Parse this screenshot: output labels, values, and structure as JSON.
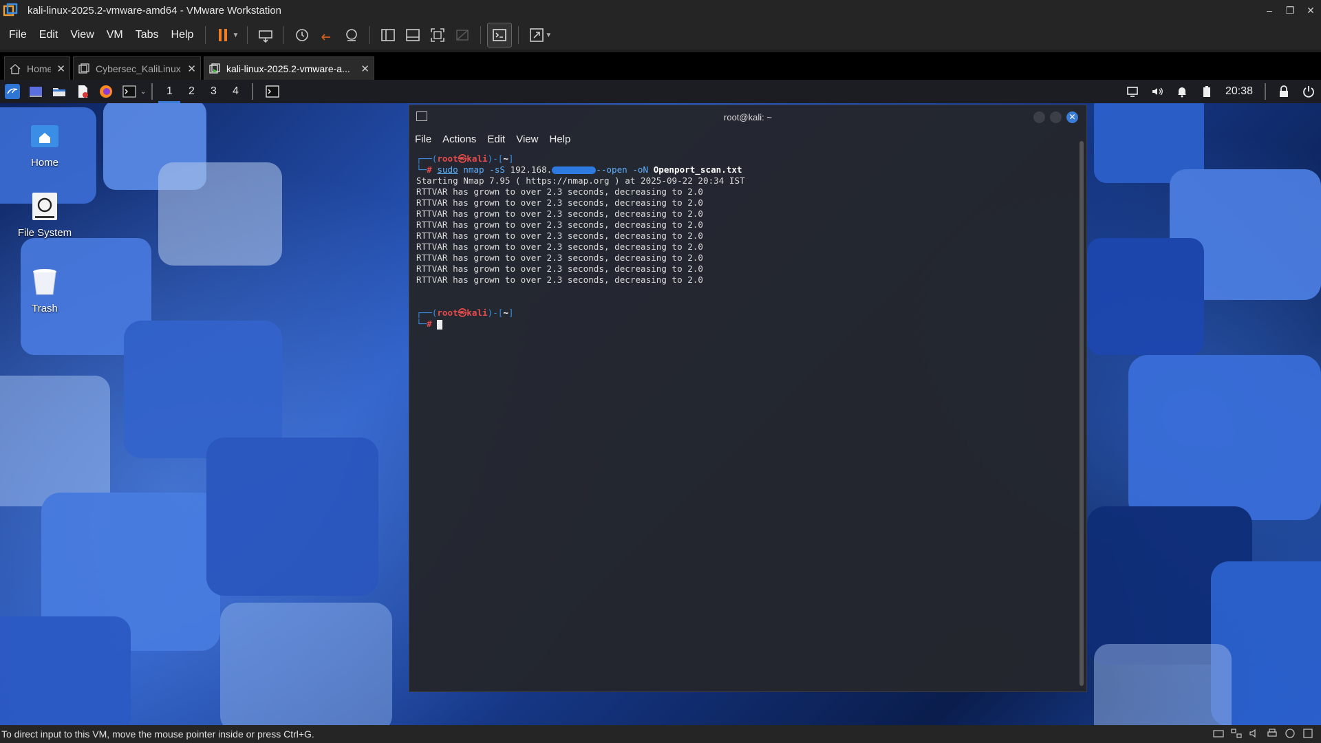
{
  "window": {
    "title": "kali-linux-2025.2-vmware-amd64 - VMware Workstation",
    "controls": [
      "minimize-icon",
      "restore-icon",
      "close-icon"
    ]
  },
  "menubar": {
    "items": [
      "File",
      "Edit",
      "View",
      "VM",
      "Tabs",
      "Help"
    ]
  },
  "tabs": [
    {
      "label": "Home",
      "icon": "home-icon"
    },
    {
      "label": "Cybersec_KaliLinux",
      "icon": "vm-icon"
    },
    {
      "label": "kali-linux-2025.2-vmware-a...",
      "icon": "vm-running-icon"
    }
  ],
  "guest_panel": {
    "workspaces": [
      "1",
      "2",
      "3",
      "4"
    ],
    "active_workspace": "1",
    "clock": "20:38"
  },
  "desktop_icons": [
    {
      "label": "Home"
    },
    {
      "label": "File System"
    },
    {
      "label": "Trash"
    }
  ],
  "terminal": {
    "title": "root@kali: ~",
    "menu": [
      "File",
      "Actions",
      "Edit",
      "View",
      "Help"
    ],
    "prompt_user": "root",
    "prompt_at": "㉿",
    "prompt_host": "kali",
    "prompt_dir": "~",
    "cmd_sudo": "sudo",
    "cmd_nmap": "nmap",
    "cmd_flag": "-sS",
    "cmd_ip": "192.168.",
    "cmd_open": "--open",
    "cmd_on": "-oN",
    "cmd_file": "Openport_scan.txt",
    "output_start": "Starting Nmap 7.95 ( https://nmap.org ) at 2025-09-22 20:34 IST",
    "rttvar_line": "RTTVAR has grown to over 2.3 seconds, decreasing to 2.0",
    "rttvar_count": 9
  },
  "statusbar": {
    "message": "To direct input to this VM, move the mouse pointer inside or press Ctrl+G."
  },
  "colors": {
    "accent": "#3a7bd5",
    "prompt_red": "#e54b4b",
    "pause_orange": "#f07c24"
  }
}
